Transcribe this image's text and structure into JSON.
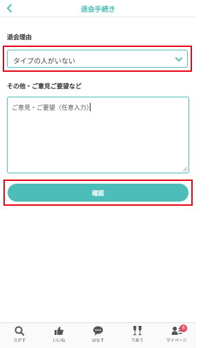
{
  "header": {
    "title": "退会手続き"
  },
  "form": {
    "reason_label": "退会理由",
    "reason_value": "タイプの人がいない",
    "comments_label": "その他・ご意見ご要望など",
    "comments_placeholder": "ご意見・ご要望（任意入力）",
    "confirm_label": "確認"
  },
  "tabs": [
    {
      "label": "さがす",
      "icon": "search-icon"
    },
    {
      "label": "いいね",
      "icon": "thumbs-up-icon"
    },
    {
      "label": "はなす",
      "icon": "chat-icon"
    },
    {
      "label": "であう",
      "icon": "glasses-icon"
    },
    {
      "label": "マイページ",
      "icon": "profile-icon",
      "badge": "6"
    }
  ],
  "colors": {
    "accent": "#4dbdba",
    "highlight": "#e60012",
    "badge": "#e84a5f"
  }
}
